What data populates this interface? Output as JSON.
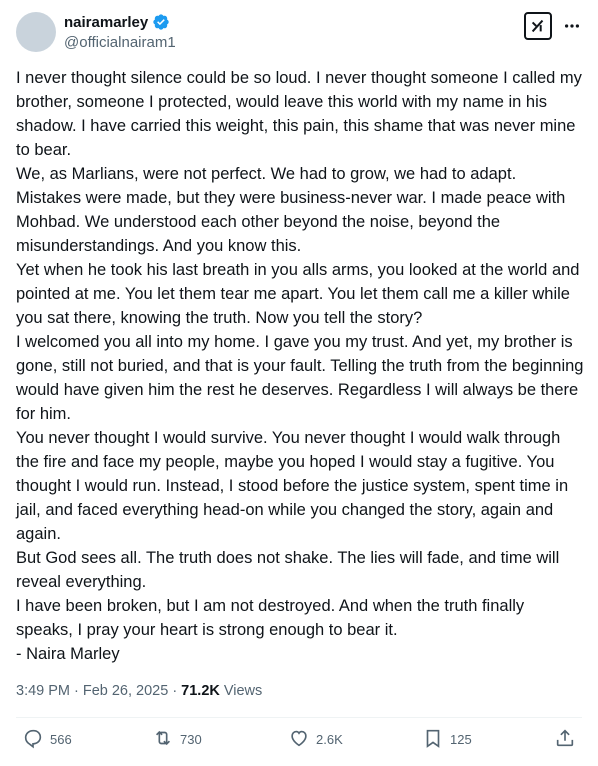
{
  "author": {
    "display_name": "nairamarley",
    "handle": "@officialnairam1",
    "verified": true
  },
  "post": {
    "text": "I never thought silence could be so loud. I never thought someone I called my brother, someone I protected, would leave this world with my name in his shadow. I have carried this weight, this pain, this shame that was never mine to bear.\nWe, as Marlians, were not perfect. We had to grow, we had to adapt. Mistakes were made, but they were business-never war. I made peace with Mohbad. We understood each other beyond the noise, beyond the misunderstandings. And you know this.\nYet when he took his last breath in you alls arms, you looked at the world and pointed at me. You let them tear me apart. You let them call me a killer while you sat there, knowing the truth. Now you tell the story?\nI welcomed you all into my home. I gave you my trust. And yet, my brother is gone, still not buried, and that is your fault. Telling the truth from the beginning would have given him the rest he deserves. Regardless I will always be there for him.\nYou never thought I would survive. You never thought I would walk through the fire and face my people, maybe you hoped I would stay a fugitive. You thought I would run. Instead, I stood before the justice system, spent time in jail, and faced everything head-on while you changed the story, again and again.\nBut God sees all. The truth does not shake. The lies will fade, and time will reveal everything.\nI have been broken, but I am not destroyed. And when the truth finally speaks, I pray your heart is strong enough to bear it.\n- Naira Marley",
    "time": "3:49 PM",
    "date": "Feb 26, 2025",
    "separator": "·",
    "views_count": "71.2K",
    "views_label": "Views"
  },
  "actions": {
    "replies": "566",
    "reposts": "730",
    "likes": "2.6K",
    "bookmarks": "125"
  },
  "icons": [
    "verified-badge-icon",
    "grok-icon",
    "more-icon",
    "reply-icon",
    "repost-icon",
    "like-icon",
    "bookmark-icon",
    "share-icon"
  ],
  "colors": {
    "accent": "#1d9bf0",
    "text": "#0f1419",
    "muted": "#536471"
  }
}
